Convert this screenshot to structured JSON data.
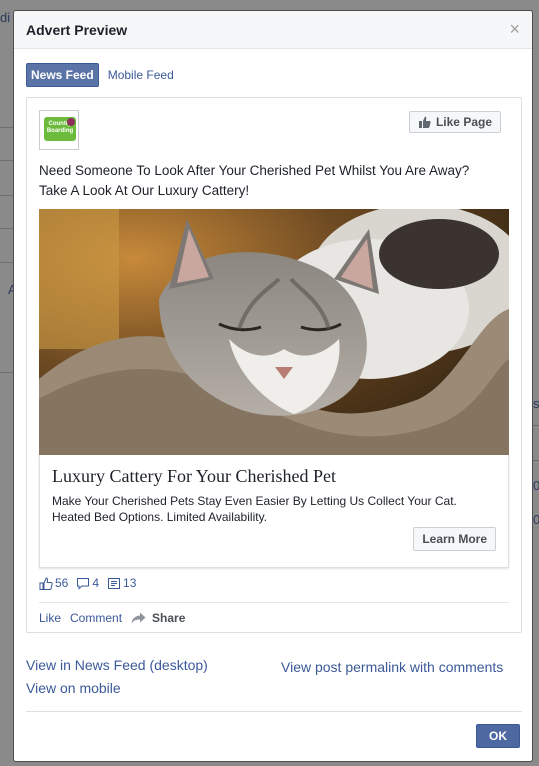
{
  "background": {
    "fragments": [
      "di",
      "s",
      "A",
      "0",
      "0"
    ]
  },
  "modal": {
    "title": "Advert Preview",
    "close_symbol": "×",
    "tabs": [
      {
        "label": "News Feed",
        "active": true
      },
      {
        "label": "Mobile Feed",
        "active": false
      }
    ]
  },
  "ad": {
    "logo_text": "Country Boarding",
    "like_page_label": "Like Page",
    "text_line1": "Need Someone To Look After Your Cherished Pet Whilst You Are Away?",
    "text_line2": "Take A Look At Our Luxury Cattery!",
    "link_title": "Luxury Cattery For Your Cherished Pet",
    "link_desc_line1": "Make Your Cherished Pets Stay Even Easier By Letting Us Collect Your Cat.",
    "link_desc_line2": "Heated Bed Options. Limited Availability.",
    "cta_label": "Learn More",
    "counts": {
      "likes": "56",
      "comments": "4",
      "shares": "13"
    },
    "actions": {
      "like": "Like",
      "comment": "Comment",
      "share": "Share"
    }
  },
  "footer": {
    "view_news_feed": "View in News Feed (desktop)",
    "view_mobile": "View on mobile",
    "view_permalink": "View post permalink with comments",
    "ok_label": "OK"
  },
  "colors": {
    "accent": "#3b5998",
    "tab_active": "#5b74a8",
    "ok_button": "#4e69a2",
    "logo_green": "#6cbb3c"
  }
}
